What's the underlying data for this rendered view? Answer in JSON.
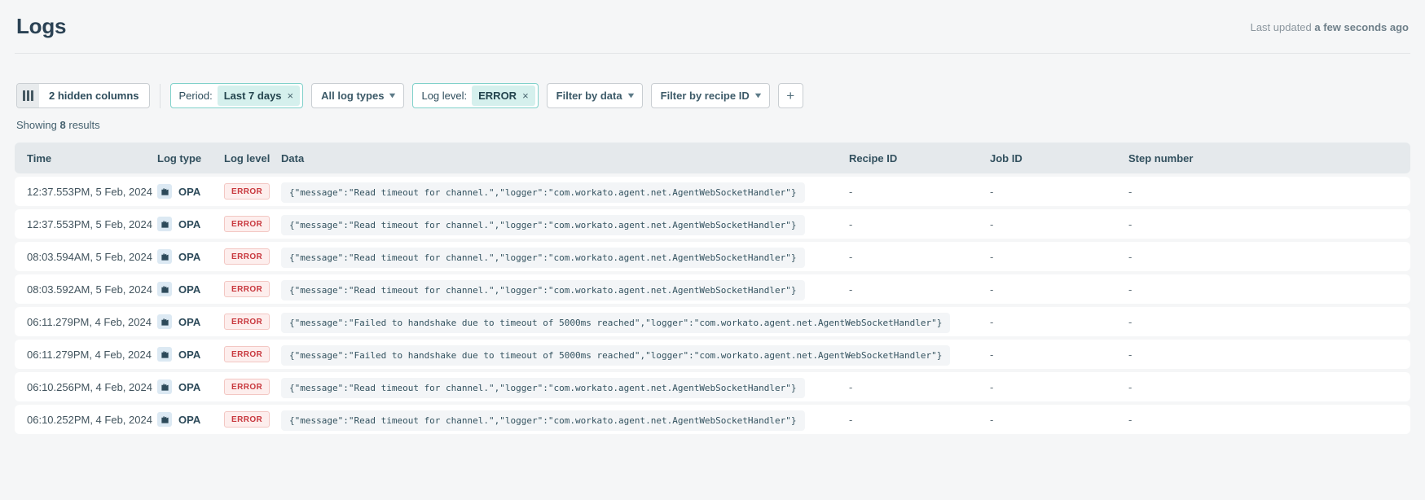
{
  "page": {
    "title": "Logs",
    "last_updated_label": "Last updated",
    "last_updated_value": "a few seconds ago"
  },
  "toolbar": {
    "hidden_columns_label": "2 hidden columns",
    "period_filter": {
      "label": "Period:",
      "value": "Last 7 days"
    },
    "log_type_filter": {
      "label": "All log types"
    },
    "log_level_filter": {
      "label": "Log level:",
      "value": "ERROR"
    },
    "data_filter": {
      "label": "Filter by data"
    },
    "recipe_filter": {
      "label": "Filter by recipe ID"
    }
  },
  "icons": {
    "chevron_down": "▾",
    "remove": "×",
    "add": "+",
    "columns_icon": "columns-icon",
    "opa_icon": "on-prem-agent-icon"
  },
  "results": {
    "prefix": "Showing",
    "count": "8",
    "suffix": "results"
  },
  "colors": {
    "heading": "#2b4254",
    "accent_teal_border": "#7fd1ca",
    "accent_teal_bg": "#d5f0ed",
    "error_text": "#c8383e",
    "error_bg": "#fdeeed",
    "error_border": "#f3c7c3",
    "table_header_bg": "#e5e9ec",
    "row_bg": "#ffffff",
    "page_bg": "#f5f6f7",
    "opa_icon_bg": "#dce9f3"
  },
  "table": {
    "columns": [
      "Time",
      "Log type",
      "Log level",
      "Data",
      "Recipe ID",
      "Job ID",
      "Step number"
    ],
    "rows": [
      {
        "time": "12:37.553PM, 5 Feb, 2024",
        "log_type": "OPA",
        "log_level": "ERROR",
        "data": "{\"message\":\"Read timeout for channel.\",\"logger\":\"com.workato.agent.net.AgentWebSocketHandler\"}",
        "recipe_id": "-",
        "job_id": "-",
        "step_number": "-"
      },
      {
        "time": "12:37.553PM, 5 Feb, 2024",
        "log_type": "OPA",
        "log_level": "ERROR",
        "data": "{\"message\":\"Read timeout for channel.\",\"logger\":\"com.workato.agent.net.AgentWebSocketHandler\"}",
        "recipe_id": "-",
        "job_id": "-",
        "step_number": "-"
      },
      {
        "time": "08:03.594AM, 5 Feb, 2024",
        "log_type": "OPA",
        "log_level": "ERROR",
        "data": "{\"message\":\"Read timeout for channel.\",\"logger\":\"com.workato.agent.net.AgentWebSocketHandler\"}",
        "recipe_id": "-",
        "job_id": "-",
        "step_number": "-"
      },
      {
        "time": "08:03.592AM, 5 Feb, 2024",
        "log_type": "OPA",
        "log_level": "ERROR",
        "data": "{\"message\":\"Read timeout for channel.\",\"logger\":\"com.workato.agent.net.AgentWebSocketHandler\"}",
        "recipe_id": "-",
        "job_id": "-",
        "step_number": "-"
      },
      {
        "time": "06:11.279PM, 4 Feb, 2024",
        "log_type": "OPA",
        "log_level": "ERROR",
        "data": "{\"message\":\"Failed to handshake due to timeout of 5000ms reached\",\"logger\":\"com.workato.agent.net.AgentWebSocketHandler\"}",
        "recipe_id": "-",
        "job_id": "-",
        "step_number": "-"
      },
      {
        "time": "06:11.279PM, 4 Feb, 2024",
        "log_type": "OPA",
        "log_level": "ERROR",
        "data": "{\"message\":\"Failed to handshake due to timeout of 5000ms reached\",\"logger\":\"com.workato.agent.net.AgentWebSocketHandler\"}",
        "recipe_id": "-",
        "job_id": "-",
        "step_number": "-"
      },
      {
        "time": "06:10.256PM, 4 Feb, 2024",
        "log_type": "OPA",
        "log_level": "ERROR",
        "data": "{\"message\":\"Read timeout for channel.\",\"logger\":\"com.workato.agent.net.AgentWebSocketHandler\"}",
        "recipe_id": "-",
        "job_id": "-",
        "step_number": "-"
      },
      {
        "time": "06:10.252PM, 4 Feb, 2024",
        "log_type": "OPA",
        "log_level": "ERROR",
        "data": "{\"message\":\"Read timeout for channel.\",\"logger\":\"com.workato.agent.net.AgentWebSocketHandler\"}",
        "recipe_id": "-",
        "job_id": "-",
        "step_number": "-"
      }
    ]
  }
}
